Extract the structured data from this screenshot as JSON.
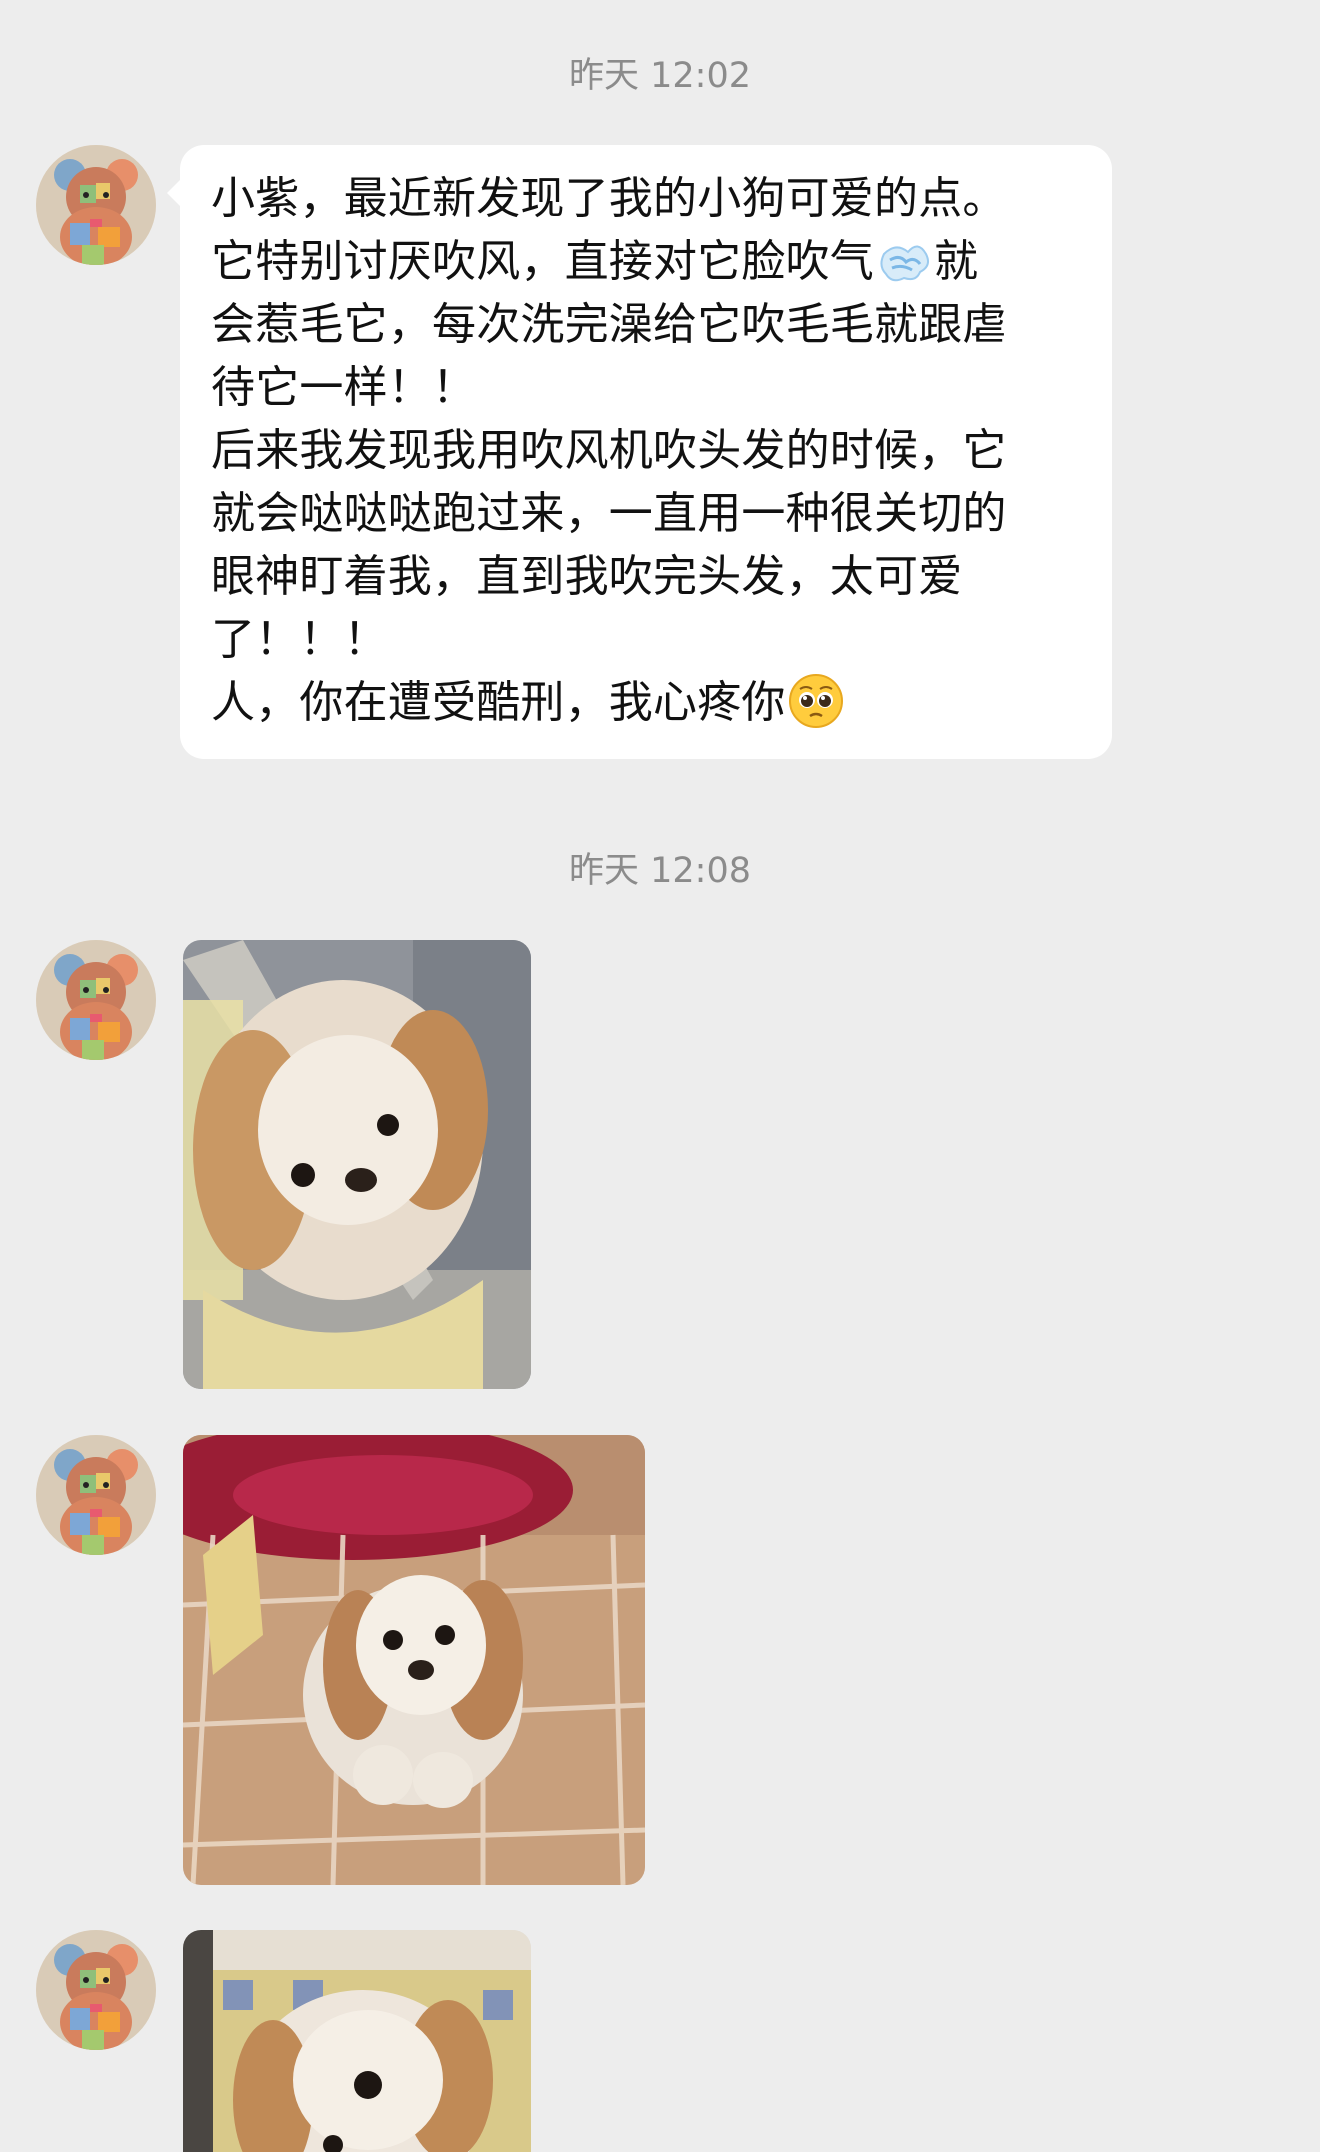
{
  "chat": {
    "timestamps": [
      "昨天 12:02",
      "昨天 12:08"
    ],
    "text_message": {
      "line1": "小紫，最近新发现了我的小狗可爱的点。",
      "line2_before": "它特别讨厌吹风，直接对它脸吹气",
      "line2_after": "就",
      "line3": "会惹毛它，每次洗完澡给它吹毛毛就跟虐",
      "line4": "待它一样！！",
      "line5": "后来我发现我用吹风机吹头发的时候，它",
      "line6": "就会哒哒哒跑过来，一直用一种很关切的",
      "line7": "眼神盯着我，直到我吹完头发，太可爱",
      "line8": "了！！！",
      "line9_before": "人，你在遭受酷刑，我心疼你"
    },
    "emojis": {
      "blow": "dashing-away-icon",
      "pleading": "pleading-face-icon"
    },
    "photos": [
      {
        "icon": "dog-photo"
      },
      {
        "icon": "dog-photo"
      },
      {
        "icon": "dog-photo"
      }
    ]
  },
  "colors": {
    "background": "#ededed",
    "bubble": "#ffffff",
    "timestamp": "#8b8b8b",
    "text": "#111111"
  }
}
